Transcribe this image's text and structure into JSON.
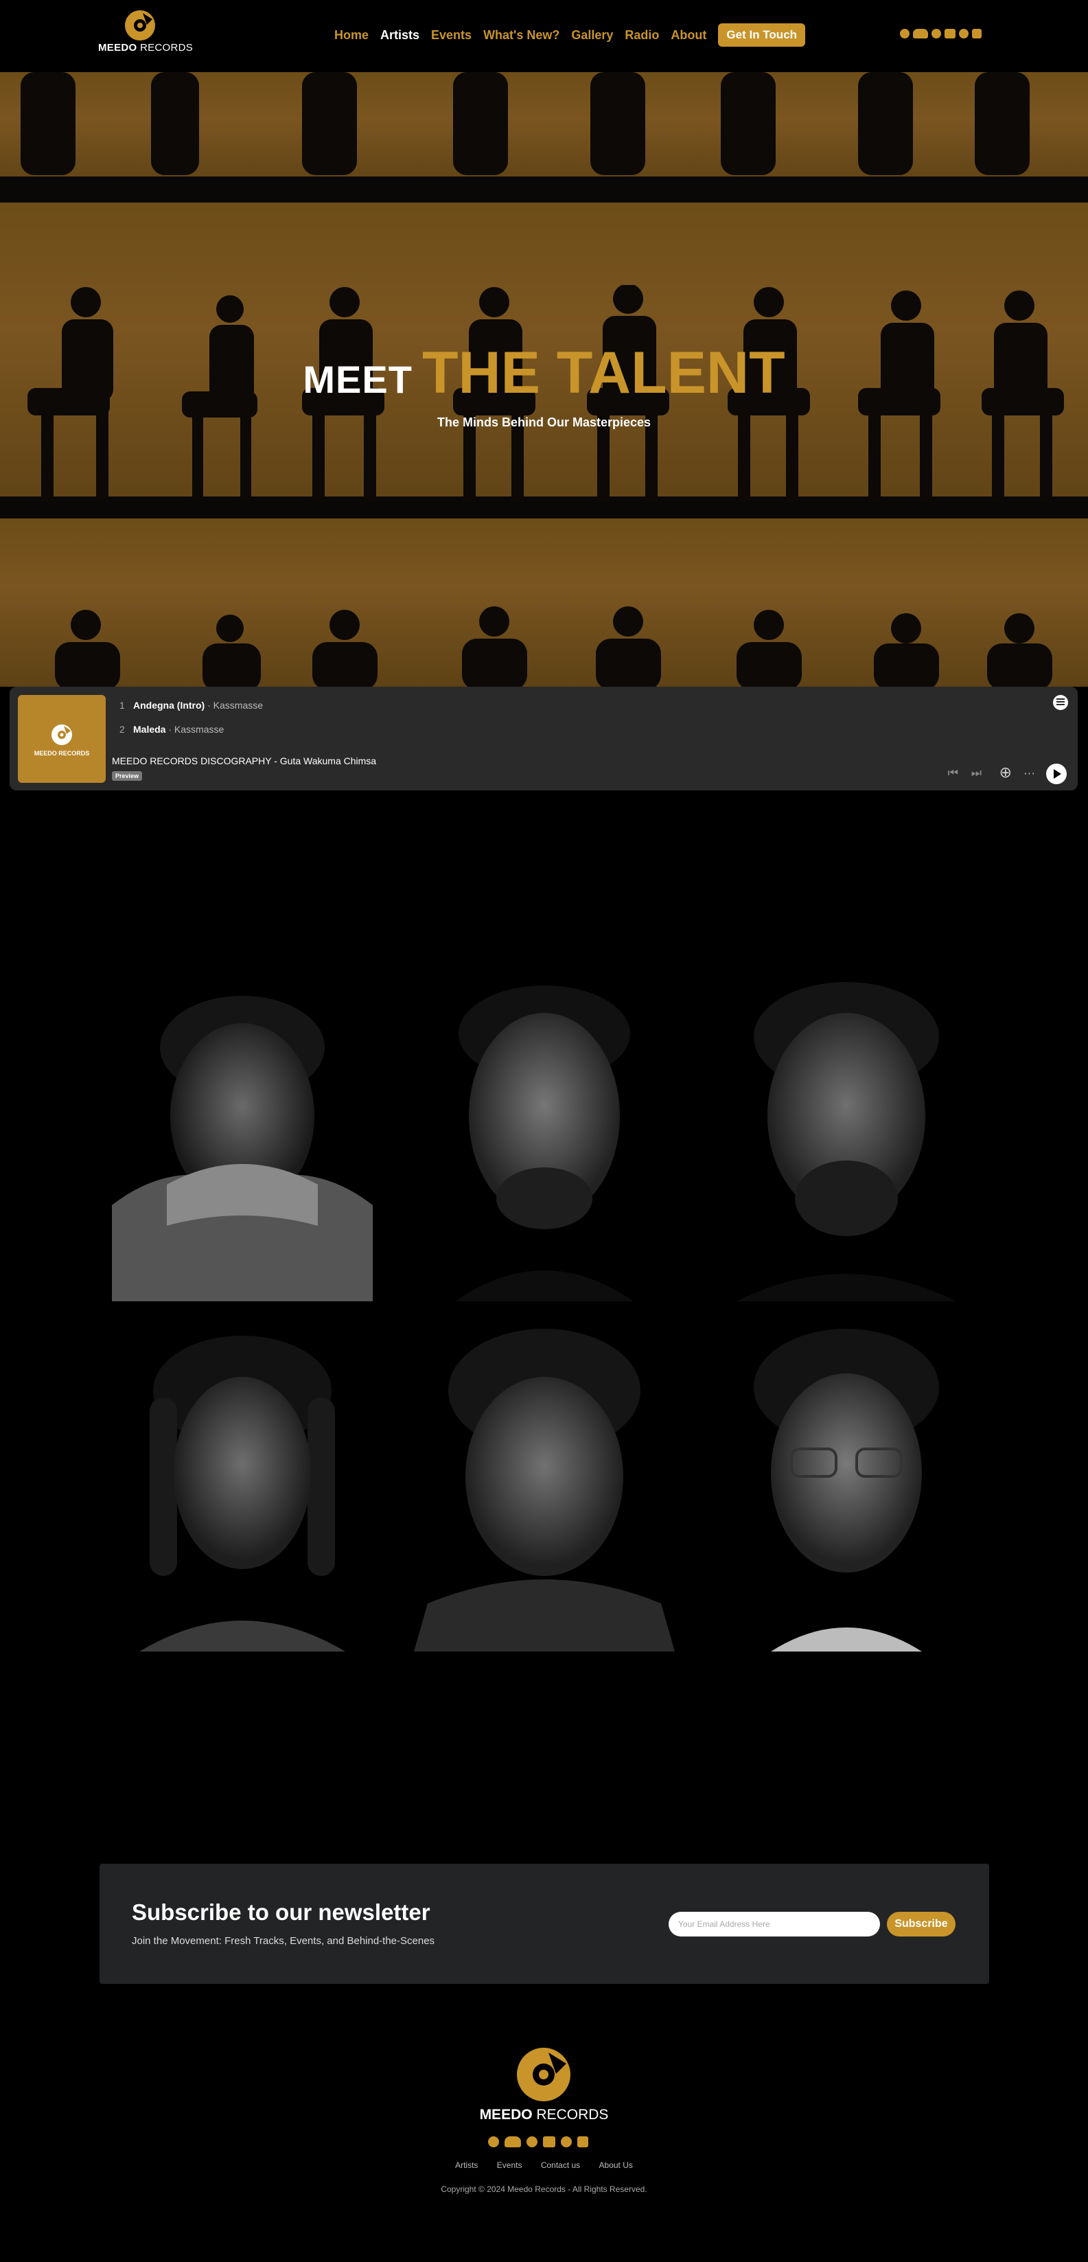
{
  "brand": {
    "name_bold": "MEEDO",
    "name_rest": " RECORDS",
    "accent": "#c9952a"
  },
  "nav": {
    "items": [
      {
        "label": "Home",
        "active": false
      },
      {
        "label": "Artists",
        "active": true
      },
      {
        "label": "Events",
        "active": false
      },
      {
        "label": "What's New?",
        "active": false
      },
      {
        "label": "Gallery",
        "active": false
      },
      {
        "label": "Radio",
        "active": false
      },
      {
        "label": "About",
        "active": false
      }
    ],
    "cta": "Get In Touch"
  },
  "social_icons": [
    "facebook-icon",
    "soundcloud-icon",
    "spotify-icon",
    "youtube-icon",
    "tiktok-icon",
    "instagram-icon"
  ],
  "hero": {
    "title_word1": "MEET",
    "title_word2": "THE TALENT",
    "subtitle": "The Minds Behind Our Masterpieces"
  },
  "player": {
    "cover_text": "MEEDO RECORDS",
    "tracks": [
      {
        "num": "1",
        "title": "Andegna (Intro)",
        "artist": "Kassmasse"
      },
      {
        "num": "2",
        "title": "Maleda",
        "artist": "Kassmasse"
      }
    ],
    "separator": " · ",
    "playlist_title": "MEEDO RECORDS DISCOGRAPHY - Guta Wakuma Chimsa",
    "badge": "Preview"
  },
  "artists_count": 6,
  "newsletter": {
    "title": "Subscribe to our newsletter",
    "subtitle": "Join the Movement: Fresh Tracks, Events, and Behind-the-Scenes",
    "placeholder": "Your Email Address Here",
    "button": "Subscribe"
  },
  "footer": {
    "brand_bold": "MEEDO",
    "brand_rest": " RECORDS",
    "links": [
      "Artists",
      "Events",
      "Contact us",
      "About Us"
    ],
    "copyright": "Copyright © 2024 Meedo Records - All Rights Reserved."
  }
}
